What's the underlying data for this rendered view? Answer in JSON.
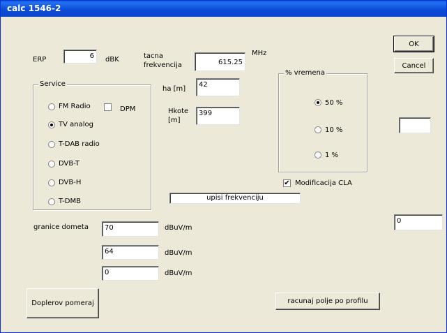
{
  "title": "calc 1546-2",
  "erp": {
    "label": "ERP",
    "value": "6",
    "unit": "dBK"
  },
  "freq": {
    "label_line1": "tacna",
    "label_line2": "frekvencija",
    "value": "615.25",
    "unit": "MHz"
  },
  "ha": {
    "label": "ha [m]",
    "value": "42"
  },
  "hkote": {
    "label_line1": "Hkote",
    "label_line2": "[m]",
    "value": "399"
  },
  "service": {
    "legend": "Service",
    "options": [
      "FM Radio",
      "TV analog",
      "T-DAB radio",
      "DVB-T",
      "DVB-H",
      "T-DMB"
    ],
    "selected": "TV analog",
    "dpm_label": "DPM"
  },
  "vremena": {
    "legend": "% vremena",
    "options": [
      "50 %",
      "10 %",
      "1 %"
    ],
    "selected": "50 %"
  },
  "modifikacija": {
    "label": "Modificacija CLA",
    "checked": true
  },
  "status": "upisi frekvenciju",
  "buttons": {
    "ok": "OK",
    "cancel": "Cancel",
    "dopler": "Doplerov pomeraj",
    "profil": "racunaj polje po profilu"
  },
  "granice": {
    "label": "granice dometa",
    "fields": [
      {
        "value": "70",
        "unit": "dBuV/m"
      },
      {
        "value": "64",
        "unit": "dBuV/m"
      },
      {
        "value": "0",
        "unit": "dBuV/m"
      }
    ]
  },
  "right_blank_field": "",
  "right_value_field": "0"
}
